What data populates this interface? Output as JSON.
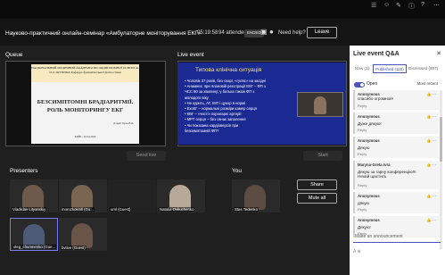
{
  "window": {
    "title": "Науково-практичний онлайн-семінар «Амбулаторне моніторування ЕКГ»",
    "timer": "05:19:58",
    "attendees": "94 attendees",
    "status_badge": "ENDED",
    "need_help": "Need help?",
    "leave_label": "Leave"
  },
  "queue": {
    "label": "Queue",
    "send_live_label": "Send live",
    "slide": {
      "header": "НАЦІОНАЛЬНИЙ МЕДИЧНИЙ АКАДЕМІЯ ПІСЛЯДИПЛОМНОЇ ОСВІТИ ім. П.Л. ШУПИКА Кафедра функціональної діагностики",
      "title": "БЕЗСИМПТОМНІ БРАДІАРИТМІЇ. РОЛЬ МОНІТОРИНГУ ЕКГ",
      "author": "Доцент Куць В.О.",
      "footer": "КИЇВ – 16.04.2020"
    }
  },
  "live": {
    "label": "Live event",
    "start_label": "Start",
    "slide": {
      "title": "Типова клінічна ситуація",
      "bullets": [
        "• Чоловік 37 років, без скарг, «гуляє» на засідні",
        "• Анамнез: при плановій реєстрації ЕКГ – ФП з",
        "  ЧСС 90 за хвилину; у батька також ФП з",
        "  молодого віку",
        "• Не курить, АТ, ІМТ і цукор в нормі",
        "• ЕхоКГ – нормальні розміри камер серця",
        "• КВГ – «чисті» коронарні артерії",
        "• МРТ серця – без ознак запалення",
        "• Чи показана кардіоверсія при",
        "  безсимптомній ФП?"
      ]
    }
  },
  "presenters": {
    "label": "Presenters",
    "tiles": [
      {
        "name": "Vladislav Lityanskiy"
      },
      {
        "name": "morozkokirill (Gu..."
      },
      {
        "name": "uml (Guest)"
      },
      {
        "name": "Natalia Ovkuchenko"
      },
      {
        "name": "oleg_chumnenko (Gue..."
      },
      {
        "name": "bvtive (Guest)"
      }
    ]
  },
  "you": {
    "label": "You",
    "name": "Stas Tedenko",
    "share_label": "Share",
    "mute_all_label": "Mute all"
  },
  "qa": {
    "title": "Live event Q&A",
    "tabs": [
      "New (1)",
      "Published (118)",
      "Dismissed (607)"
    ],
    "open_label": "Open",
    "sort_label": "Most recent",
    "reply_label": "Reply",
    "items": [
      {
        "author": "Anonymous",
        "time": "",
        "text": "спасибо огромное!"
      },
      {
        "author": "Anonymous",
        "time": "",
        "text": "Дуже дякую!"
      },
      {
        "author": "Anonymous",
        "time": "",
        "text": "Дякую"
      },
      {
        "author": "Maryna-Greta Ivra",
        "time": "",
        "text": "Дякую за гарну конференцію!!!Нехай щастить"
      },
      {
        "author": "Anonymous",
        "time": "",
        "text": "дякую"
      },
      {
        "author": "Anonymous",
        "time": "",
        "text": "Дякую!"
      }
    ],
    "announce_placeholder": "Make an announcement"
  }
}
